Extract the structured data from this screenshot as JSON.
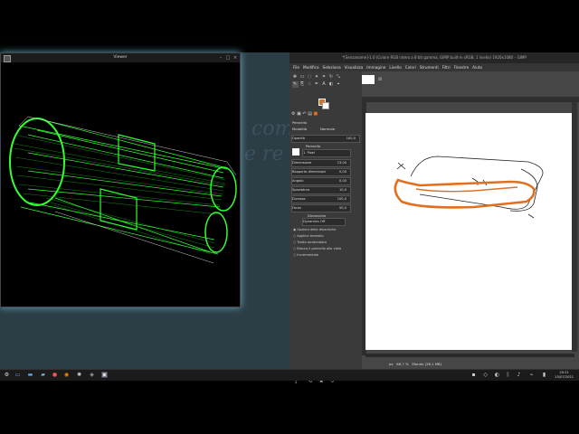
{
  "desktop": {
    "bg_text_1": "com",
    "bg_text_2": "e re"
  },
  "viewer": {
    "title": "Viewer"
  },
  "gimp": {
    "title": "*[Senzanome]-1.0 (Colore RGB intero a 8 bit gamma, GIMP built-in sRGB, 1 livello) 1920x1080 – GIMP",
    "menus": [
      "File",
      "Modifica",
      "Seleziona",
      "Visualizza",
      "Immagine",
      "Livello",
      "Colori",
      "Strumenti",
      "Filtri",
      "Finestre",
      "Aiuto"
    ],
    "tool_options": {
      "header": "Pennello",
      "mode_label": "Modalità",
      "mode_value": "Normale",
      "opacity_label": "Opacità",
      "opacity_value": "100,0",
      "brush_label": "Pennello",
      "brush_value": "1. Pixel",
      "rows": [
        {
          "label": "Dimensione",
          "value": "13,00"
        },
        {
          "label": "Rapporto dimensioni",
          "value": "0,00"
        },
        {
          "label": "Angolo",
          "value": "0,00"
        },
        {
          "label": "Spaziatura",
          "value": "10,0"
        },
        {
          "label": "Durezza",
          "value": "100,0"
        },
        {
          "label": "Forza",
          "value": "50,0"
        }
      ],
      "dynamics_label": "Dinamiche",
      "dynamics_value": "Dynamics Off",
      "options": [
        "Opzioni delle dinamiche",
        "Applica tremolio",
        "Tratto arrotondato",
        "Blocca il pennello alla vista",
        "Incrementale"
      ]
    },
    "status": {
      "unit": "px",
      "zoom": "66,7 %",
      "layer_info": "Sfondo (26,1 MB)"
    }
  },
  "taskbar": {
    "time": "20:21",
    "date": "15/07/2021"
  },
  "colors": {
    "accent": "#e07020",
    "wire": "#33ff33"
  }
}
